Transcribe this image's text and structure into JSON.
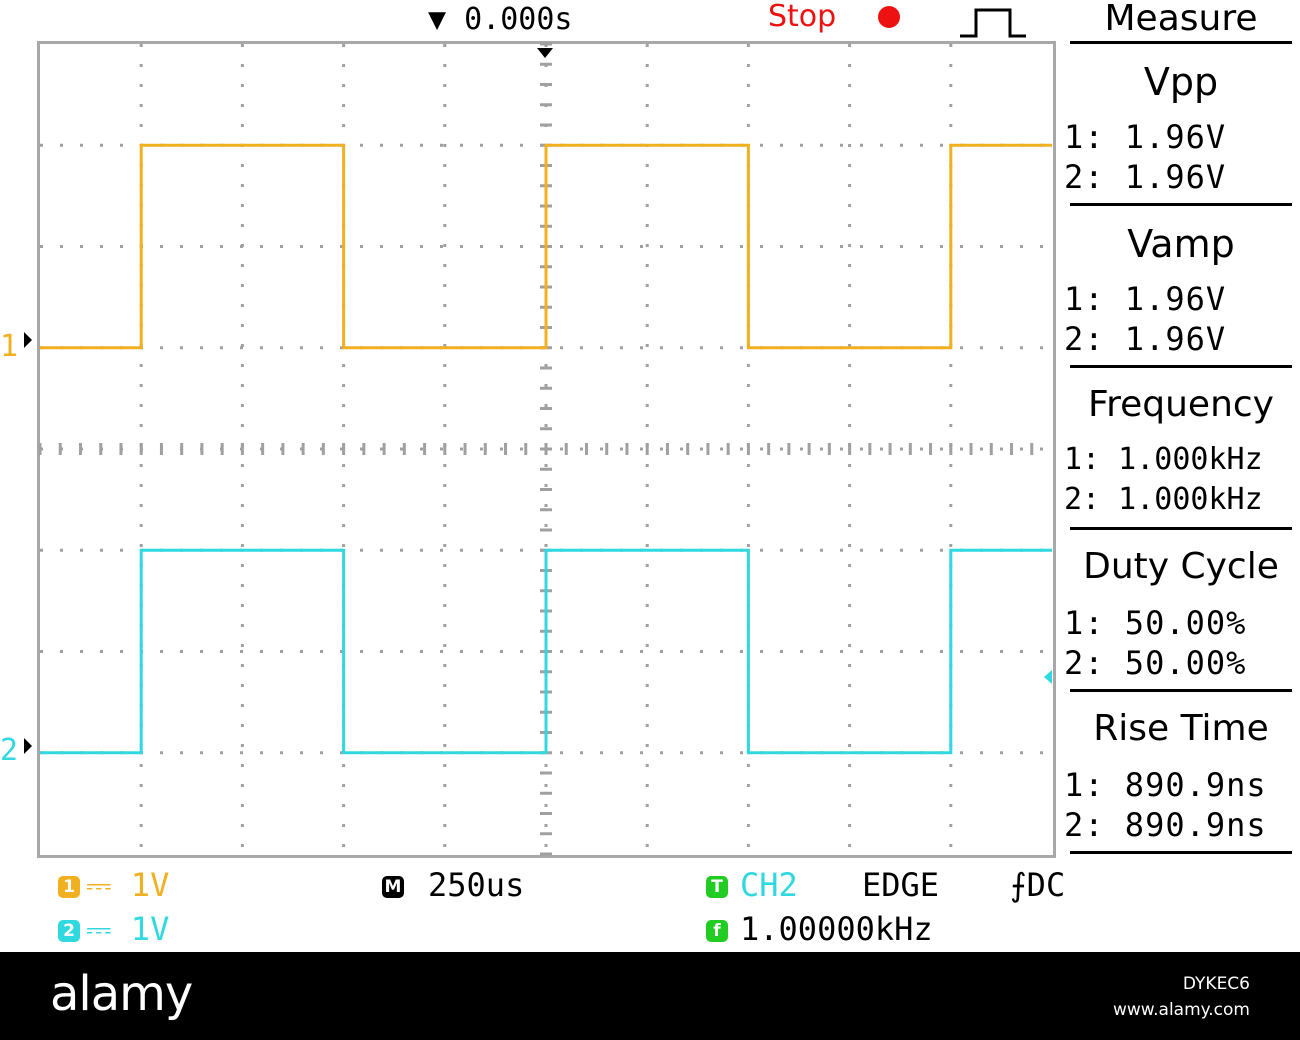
{
  "header": {
    "trigger_time": "▼ 0.000s",
    "run_status": "Stop",
    "run_status_color": "#ee1111",
    "trigger_type_icon": "rising-pulse-icon"
  },
  "colors": {
    "ch1": "#f0b020",
    "ch2": "#30d8e0",
    "grid": "#a0a0a0",
    "frame": "#a8a8a8"
  },
  "screen": {
    "ch1_marker": "1",
    "ch2_marker": "2",
    "ch1_trace": [
      [
        0,
        1.0
      ],
      [
        1,
        1.0
      ],
      [
        1,
        3.0
      ],
      [
        3,
        3.0
      ],
      [
        3,
        1.0
      ],
      [
        5,
        1.0
      ],
      [
        5,
        3.0
      ],
      [
        7,
        3.0
      ],
      [
        7,
        1.0
      ],
      [
        9,
        1.0
      ],
      [
        9,
        3.0
      ],
      [
        10,
        3.0
      ]
    ],
    "ch2_trace": [
      [
        0,
        -3.0
      ],
      [
        1,
        -3.0
      ],
      [
        1,
        -1.0
      ],
      [
        3,
        -1.0
      ],
      [
        3,
        -3.0
      ],
      [
        5,
        -3.0
      ],
      [
        5,
        -1.0
      ],
      [
        7,
        -1.0
      ],
      [
        7,
        -3.0
      ],
      [
        9,
        -3.0
      ],
      [
        9,
        -1.0
      ],
      [
        10,
        -1.0
      ]
    ]
  },
  "measure": {
    "title": "Measure",
    "sections": [
      {
        "name": "Vpp",
        "ch1": "1: 1.96V",
        "ch2": "2: 1.96V"
      },
      {
        "name": "Vamp",
        "ch1": "1: 1.96V",
        "ch2": "2: 1.96V"
      },
      {
        "name": "Frequency",
        "ch1": "1: 1.000kHz",
        "ch2": "2: 1.000kHz"
      },
      {
        "name": "Duty Cycle",
        "ch1": "1: 50.00%",
        "ch2": "2: 50.00%"
      },
      {
        "name": "Rise Time",
        "ch1": "1: 890.9ns",
        "ch2": "2: 890.9ns"
      }
    ]
  },
  "status": {
    "ch1_badge": "1",
    "ch1_scale": "⎓ 1V",
    "ch2_badge": "2",
    "ch2_scale": "⎓ 1V",
    "timebase_badge": "M",
    "timebase": "250us",
    "trigger_badge": "T",
    "trigger_source": "CH2",
    "trigger_mode": "EDGE",
    "trigger_slope": "⨍DC",
    "freq_badge": "f",
    "trigger_freq": "1.00000kHz"
  },
  "watermark": {
    "logo": "alamy",
    "image_id": "DYKEC6",
    "site": "www.alamy.com"
  }
}
